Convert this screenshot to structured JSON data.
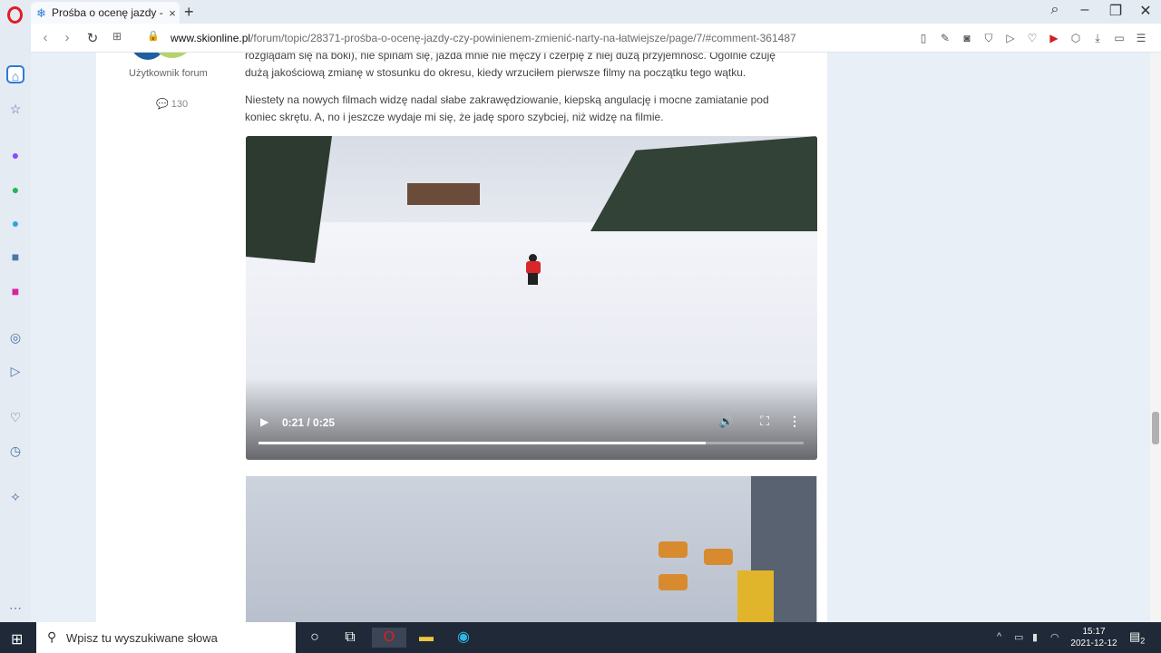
{
  "browser": {
    "tab_title": "Prośba o ocenę jazdy - czy",
    "close_tab": "×",
    "new_tab": "+",
    "url_domain": "www.skionline.pl",
    "url_path": "/forum/topic/28371-prośba-o-ocenę-jazdy-czy-powinienem-zmienić-narty-na-łatwiejsze/page/7/#comment-361487"
  },
  "post": {
    "user_role": "Użytkownik forum",
    "post_count": "130",
    "paragraph1_line1": "rozglądam się na boki), nie spinam się, jazda mnie nie męczy i czerpię z niej dużą przyjemność. Ogólnie czuję",
    "paragraph1_line2": "dużą jakościową zmianę w stosunku do okresu, kiedy wrzuciłem pierwsze filmy na początku tego wątku.",
    "paragraph2_line1": "Niestety na nowych filmach widzę nadal słabe zakrawędziowanie, kiepską angulację i mocne zamiatanie pod",
    "paragraph2_line2": "koniec skrętu. A, no i jeszcze wydaje mi się, że jadę sporo szybciej, niż widzę na filmie."
  },
  "video": {
    "time": "0:21 / 0:25",
    "progress": 0.82
  },
  "taskbar": {
    "search_placeholder": "Wpisz tu wyszukiwane słowa",
    "time": "15:17",
    "date": "2021-12-12",
    "notifications": "2"
  }
}
